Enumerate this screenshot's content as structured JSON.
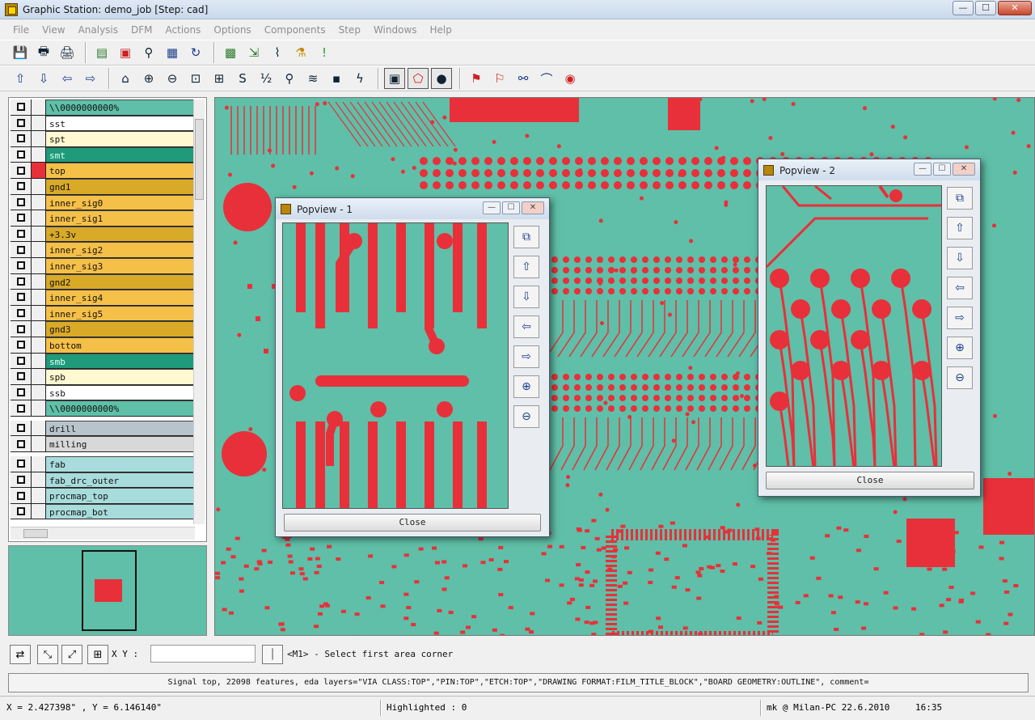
{
  "window": {
    "title": "Graphic Station: demo_job [Step: cad]",
    "minimize": "—",
    "maximize": "☐",
    "close": "✕"
  },
  "menu": [
    "File",
    "View",
    "Analysis",
    "DFM",
    "Actions",
    "Options",
    "Components",
    "Step",
    "Windows",
    "Help"
  ],
  "layers": [
    {
      "name": "\\\\0000000000%",
      "color": "#5fbfa8"
    },
    {
      "name": "sst",
      "color": "#ffffff"
    },
    {
      "name": "spt",
      "color": "#fff8d0"
    },
    {
      "name": "smt",
      "color": "#1f9a7a"
    },
    {
      "name": "top",
      "color": "#f5c048",
      "marker": "#e8303a"
    },
    {
      "name": "gnd1",
      "color": "#d9a928"
    },
    {
      "name": "inner_sig0",
      "color": "#f5c048"
    },
    {
      "name": "inner_sig1",
      "color": "#f5c048"
    },
    {
      "name": "+3.3v",
      "color": "#d9a928"
    },
    {
      "name": "inner_sig2",
      "color": "#f5c048"
    },
    {
      "name": "inner_sig3",
      "color": "#f5c048"
    },
    {
      "name": "gnd2",
      "color": "#d9a928"
    },
    {
      "name": "inner_sig4",
      "color": "#f5c048"
    },
    {
      "name": "inner_sig5",
      "color": "#f5c048"
    },
    {
      "name": "gnd3",
      "color": "#d9a928"
    },
    {
      "name": "bottom",
      "color": "#f5c048"
    },
    {
      "name": "smb",
      "color": "#1f9a7a"
    },
    {
      "name": "spb",
      "color": "#fff8d0"
    },
    {
      "name": "ssb",
      "color": "#ffffff"
    },
    {
      "name": "\\\\0000000000%",
      "color": "#5fbfa8"
    }
  ],
  "layers_drill": [
    {
      "name": "drill",
      "color": "#b8c4cc"
    },
    {
      "name": "milling",
      "color": "#d8d8d8"
    }
  ],
  "layers_doc": [
    {
      "name": "fab",
      "color": "#a8dcdc"
    },
    {
      "name": "fab_drc_outer",
      "color": "#a8dcdc"
    },
    {
      "name": "procmap_top",
      "color": "#a8dcdc"
    },
    {
      "name": "procmap_bot",
      "color": "#a8dcdc"
    }
  ],
  "popview1": {
    "title": "Popview - 1",
    "close_label": "Close"
  },
  "popview2": {
    "title": "Popview - 2",
    "close_label": "Close"
  },
  "command": {
    "xy_label": "X Y :",
    "xy_value": "",
    "prompt": "<M1> - Select first area corner"
  },
  "info": "Signal top, 22098 features, eda layers=\"VIA CLASS:TOP\",\"PIN:TOP\",\"ETCH:TOP\",\"DRAWING FORMAT:FILM_TITLE_BLOCK\",\"BOARD GEOMETRY:OUTLINE\", comment=",
  "status": {
    "coords": "X = 2.427398\" , Y = 6.146140\"",
    "highlighted": "Highlighted : 0",
    "user": "mk @ Milan-PC 22.6.2010",
    "time": "16:35"
  },
  "colors": {
    "board": "#5fbfa8",
    "copper": "#e8303a"
  }
}
